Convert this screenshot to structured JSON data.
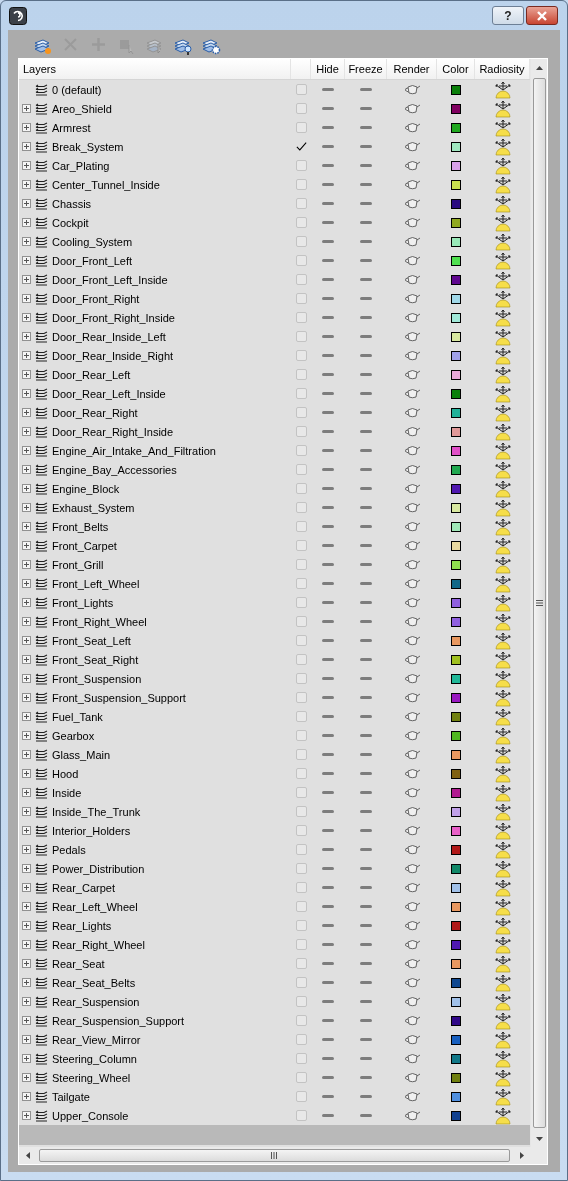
{
  "window": {
    "help_button": "?"
  },
  "toolbar": [
    {
      "kind": "new-layer",
      "disabled": false
    },
    {
      "kind": "delete",
      "disabled": true
    },
    {
      "kind": "add",
      "disabled": true
    },
    {
      "kind": "select-objects",
      "disabled": true
    },
    {
      "kind": "highlight",
      "disabled": true
    },
    {
      "kind": "hide-all",
      "disabled": false
    },
    {
      "kind": "settings",
      "disabled": false
    }
  ],
  "columns": [
    "Layers",
    "Hide",
    "Freeze",
    "Render",
    "Color",
    "Radiosity"
  ],
  "layers": [
    {
      "name": "0 (default)",
      "expandable": false,
      "checked": false,
      "color": "#0a7f0a"
    },
    {
      "name": "Areo_Shield",
      "expandable": true,
      "checked": false,
      "color": "#800060"
    },
    {
      "name": "Armrest",
      "expandable": true,
      "checked": false,
      "color": "#1fa81f"
    },
    {
      "name": "Break_System",
      "expandable": true,
      "checked": true,
      "color": "#a0e8c0"
    },
    {
      "name": "Car_Plating",
      "expandable": true,
      "checked": false,
      "color": "#d8a0e8"
    },
    {
      "name": "Center_Tunnel_Inside",
      "expandable": true,
      "checked": false,
      "color": "#c8e050"
    },
    {
      "name": "Chassis",
      "expandable": true,
      "checked": false,
      "color": "#2a0a80"
    },
    {
      "name": "Cockpit",
      "expandable": true,
      "checked": false,
      "color": "#90a820"
    },
    {
      "name": "Cooling_System",
      "expandable": true,
      "checked": false,
      "color": "#98e8b8"
    },
    {
      "name": "Door_Front_Left",
      "expandable": true,
      "checked": false,
      "color": "#50e050"
    },
    {
      "name": "Door_Front_Left_Inside",
      "expandable": true,
      "checked": false,
      "color": "#600890"
    },
    {
      "name": "Door_Front_Right",
      "expandable": true,
      "checked": false,
      "color": "#a0d8e8"
    },
    {
      "name": "Door_Front_Right_Inside",
      "expandable": true,
      "checked": false,
      "color": "#a0e8d8"
    },
    {
      "name": "Door_Rear_Inside_Left",
      "expandable": true,
      "checked": false,
      "color": "#d8e8a0"
    },
    {
      "name": "Door_Rear_Inside_Right",
      "expandable": true,
      "checked": false,
      "color": "#a0a0e8"
    },
    {
      "name": "Door_Rear_Left",
      "expandable": true,
      "checked": false,
      "color": "#e8a8d8"
    },
    {
      "name": "Door_Rear_Left_Inside",
      "expandable": true,
      "checked": false,
      "color": "#0a800a"
    },
    {
      "name": "Door_Rear_Right",
      "expandable": true,
      "checked": false,
      "color": "#20b098"
    },
    {
      "name": "Door_Rear_Right_Inside",
      "expandable": true,
      "checked": false,
      "color": "#e09898"
    },
    {
      "name": "Engine_Air_Intake_And_Filtration",
      "expandable": true,
      "checked": false,
      "color": "#e050c8"
    },
    {
      "name": "Engine_Bay_Accessories",
      "expandable": true,
      "checked": false,
      "color": "#20a850"
    },
    {
      "name": "Engine_Block",
      "expandable": true,
      "checked": false,
      "color": "#5018b0"
    },
    {
      "name": "Exhaust_System",
      "expandable": true,
      "checked": false,
      "color": "#d8e8a0"
    },
    {
      "name": "Front_Belts",
      "expandable": true,
      "checked": false,
      "color": "#a0e8b8"
    },
    {
      "name": "Front_Carpet",
      "expandable": true,
      "checked": false,
      "color": "#e8d8a0"
    },
    {
      "name": "Front_Grill",
      "expandable": true,
      "checked": false,
      "color": "#90e050"
    },
    {
      "name": "Front_Left_Wheel",
      "expandable": true,
      "checked": false,
      "color": "#106888"
    },
    {
      "name": "Front_Lights",
      "expandable": true,
      "checked": false,
      "color": "#9060e0"
    },
    {
      "name": "Front_Right_Wheel",
      "expandable": true,
      "checked": false,
      "color": "#9060e0"
    },
    {
      "name": "Front_Seat_Left",
      "expandable": true,
      "checked": false,
      "color": "#e89860"
    },
    {
      "name": "Front_Seat_Right",
      "expandable": true,
      "checked": false,
      "color": "#a0c020"
    },
    {
      "name": "Front_Suspension",
      "expandable": true,
      "checked": false,
      "color": "#20b898"
    },
    {
      "name": "Front_Suspension_Support",
      "expandable": true,
      "checked": false,
      "color": "#9818c0"
    },
    {
      "name": "Fuel_Tank",
      "expandable": true,
      "checked": false,
      "color": "#708010"
    },
    {
      "name": "Gearbox",
      "expandable": true,
      "checked": false,
      "color": "#50b820"
    },
    {
      "name": "Glass_Main",
      "expandable": true,
      "checked": false,
      "color": "#e89861"
    },
    {
      "name": "Hood",
      "expandable": true,
      "checked": false,
      "color": "#806010"
    },
    {
      "name": "Inside",
      "expandable": true,
      "checked": false,
      "color": "#b01890"
    },
    {
      "name": "Inside_The_Trunk",
      "expandable": true,
      "checked": false,
      "color": "#c0a0e8"
    },
    {
      "name": "Interior_Holders",
      "expandable": true,
      "checked": false,
      "color": "#e860c8"
    },
    {
      "name": "Pedals",
      "expandable": true,
      "checked": false,
      "color": "#b01818"
    },
    {
      "name": "Power_Distribution",
      "expandable": true,
      "checked": false,
      "color": "#108868"
    },
    {
      "name": "Rear_Carpet",
      "expandable": true,
      "checked": false,
      "color": "#a0c0e8"
    },
    {
      "name": "Rear_Left_Wheel",
      "expandable": true,
      "checked": false,
      "color": "#e89860"
    },
    {
      "name": "Rear_Lights",
      "expandable": true,
      "checked": false,
      "color": "#b01818"
    },
    {
      "name": "Rear_Right_Wheel",
      "expandable": true,
      "checked": false,
      "color": "#5018b0"
    },
    {
      "name": "Rear_Seat",
      "expandable": true,
      "checked": false,
      "color": "#e89860"
    },
    {
      "name": "Rear_Seat_Belts",
      "expandable": true,
      "checked": false,
      "color": "#104890"
    },
    {
      "name": "Rear_Suspension",
      "expandable": true,
      "checked": false,
      "color": "#a0c0e8"
    },
    {
      "name": "Rear_Suspension_Support",
      "expandable": true,
      "checked": false,
      "color": "#300888"
    },
    {
      "name": "Rear_View_Mirror",
      "expandable": true,
      "checked": false,
      "color": "#1860c0"
    },
    {
      "name": "Steering_Column",
      "expandable": true,
      "checked": false,
      "color": "#107888"
    },
    {
      "name": "Steering_Wheel",
      "expandable": true,
      "checked": false,
      "color": "#708010"
    },
    {
      "name": "Tailgate",
      "expandable": true,
      "checked": false,
      "color": "#5090e0"
    },
    {
      "name": "Upper_Console",
      "expandable": true,
      "checked": false,
      "color": "#104090"
    }
  ]
}
